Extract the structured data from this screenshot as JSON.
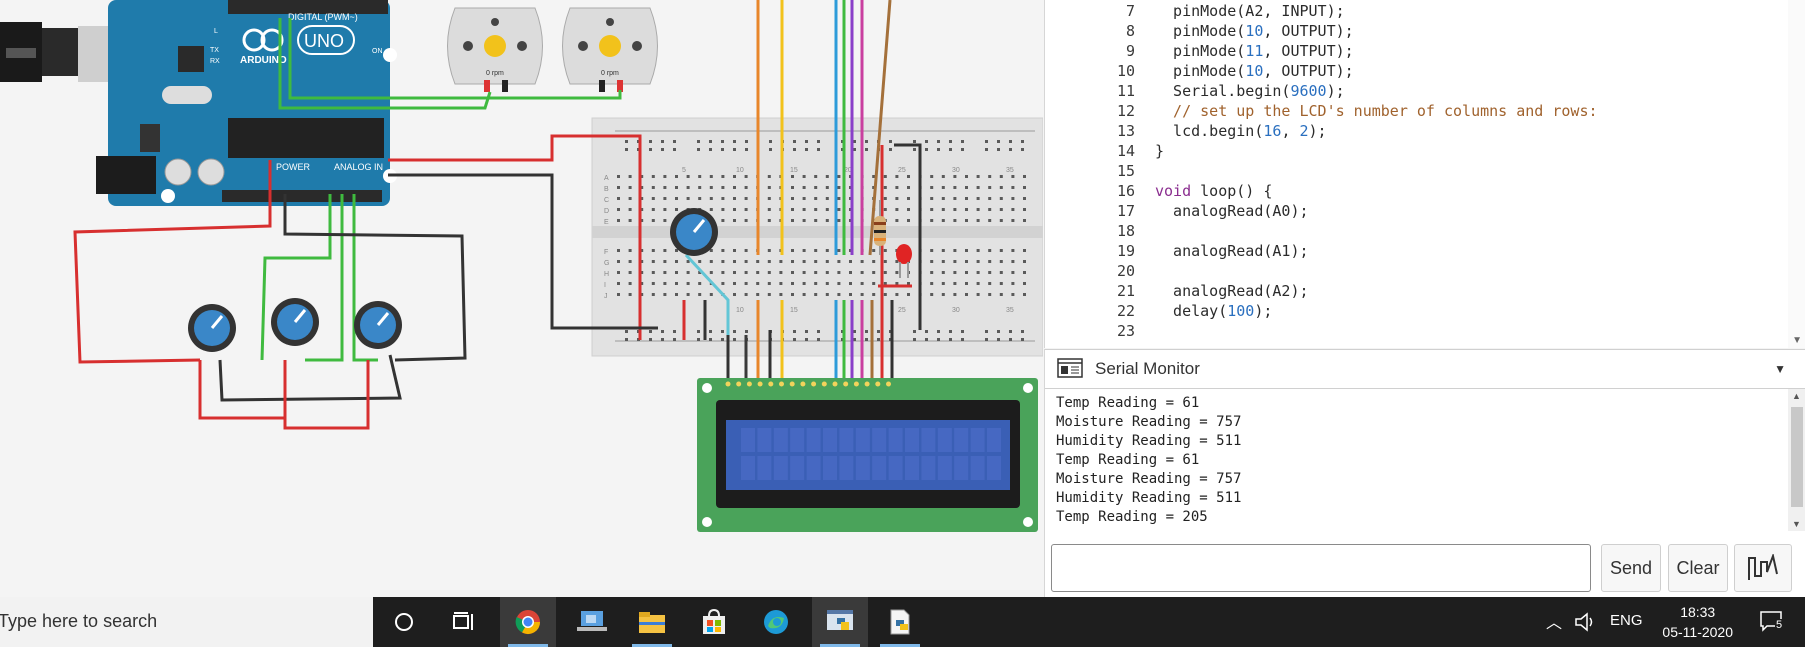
{
  "canvas": {
    "arduino": {
      "logo_text": "UNO",
      "brand": "ARDUINO",
      "digital_label": "DIGITAL (PWM~)",
      "power_label": "POWER",
      "analog_label": "ANALOG IN",
      "on_label": "ON",
      "tx_label": "TX",
      "rx_label": "RX",
      "l_label": "L"
    },
    "motors": [
      {
        "rpm": "0 rpm"
      },
      {
        "rpm": "0 rpm"
      }
    ],
    "breadboard_columns": [
      "5",
      "10",
      "15",
      "20",
      "25",
      "30",
      "35"
    ],
    "breadboard_rows": [
      "A",
      "B",
      "C",
      "D",
      "E",
      "F",
      "G",
      "H",
      "I",
      "J"
    ]
  },
  "editor": {
    "lines": [
      {
        "n": "7",
        "code": "  pinMode(A2, INPUT);"
      },
      {
        "n": "8",
        "code": "  pinMode(10, OUTPUT);"
      },
      {
        "n": "9",
        "code": "  pinMode(11, OUTPUT);"
      },
      {
        "n": "10",
        "code": "  pinMode(10, OUTPUT);"
      },
      {
        "n": "11",
        "code": "  Serial.begin(9600);"
      },
      {
        "n": "12",
        "code": "  // set up the LCD's number of columns and rows:"
      },
      {
        "n": "13",
        "code": "  lcd.begin(16, 2);"
      },
      {
        "n": "14",
        "code": "}"
      },
      {
        "n": "15",
        "code": ""
      },
      {
        "n": "16",
        "code": "void loop() {"
      },
      {
        "n": "17",
        "code": "  analogRead(A0);"
      },
      {
        "n": "18",
        "code": ""
      },
      {
        "n": "19",
        "code": "  analogRead(A1);"
      },
      {
        "n": "20",
        "code": ""
      },
      {
        "n": "21",
        "code": "  analogRead(A2);"
      },
      {
        "n": "22",
        "code": "  delay(100);"
      },
      {
        "n": "23",
        "code": ""
      }
    ]
  },
  "serial": {
    "title": "Serial Monitor",
    "output": [
      "Temp Reading = 61",
      "Moisture Reading = 757",
      "Humidity Reading = 511",
      "Temp Reading = 61",
      "Moisture Reading = 757",
      "Humidity Reading = 511",
      "Temp Reading = 205"
    ],
    "input_value": "",
    "send_label": "Send",
    "clear_label": "Clear"
  },
  "taskbar": {
    "search_placeholder": "Type here to search",
    "language": "ENG",
    "time": "18:33",
    "date": "05-11-2020",
    "notification_count": "5",
    "apps": [
      "cortana-icon",
      "task-view-icon",
      "chrome-icon",
      "desktop-app-icon",
      "file-explorer-icon",
      "store-icon",
      "edge-icon",
      "python-idle-icon",
      "python-file-icon"
    ]
  },
  "colors": {
    "arduino_board": "#1f7bab",
    "lcd_board": "#4aa35a",
    "lcd_screen": "#3a5fb5",
    "potentiometer": "#3a87c8",
    "wire_red": "#d72f2f",
    "wire_green": "#3fba3f",
    "wire_black": "#333333"
  }
}
